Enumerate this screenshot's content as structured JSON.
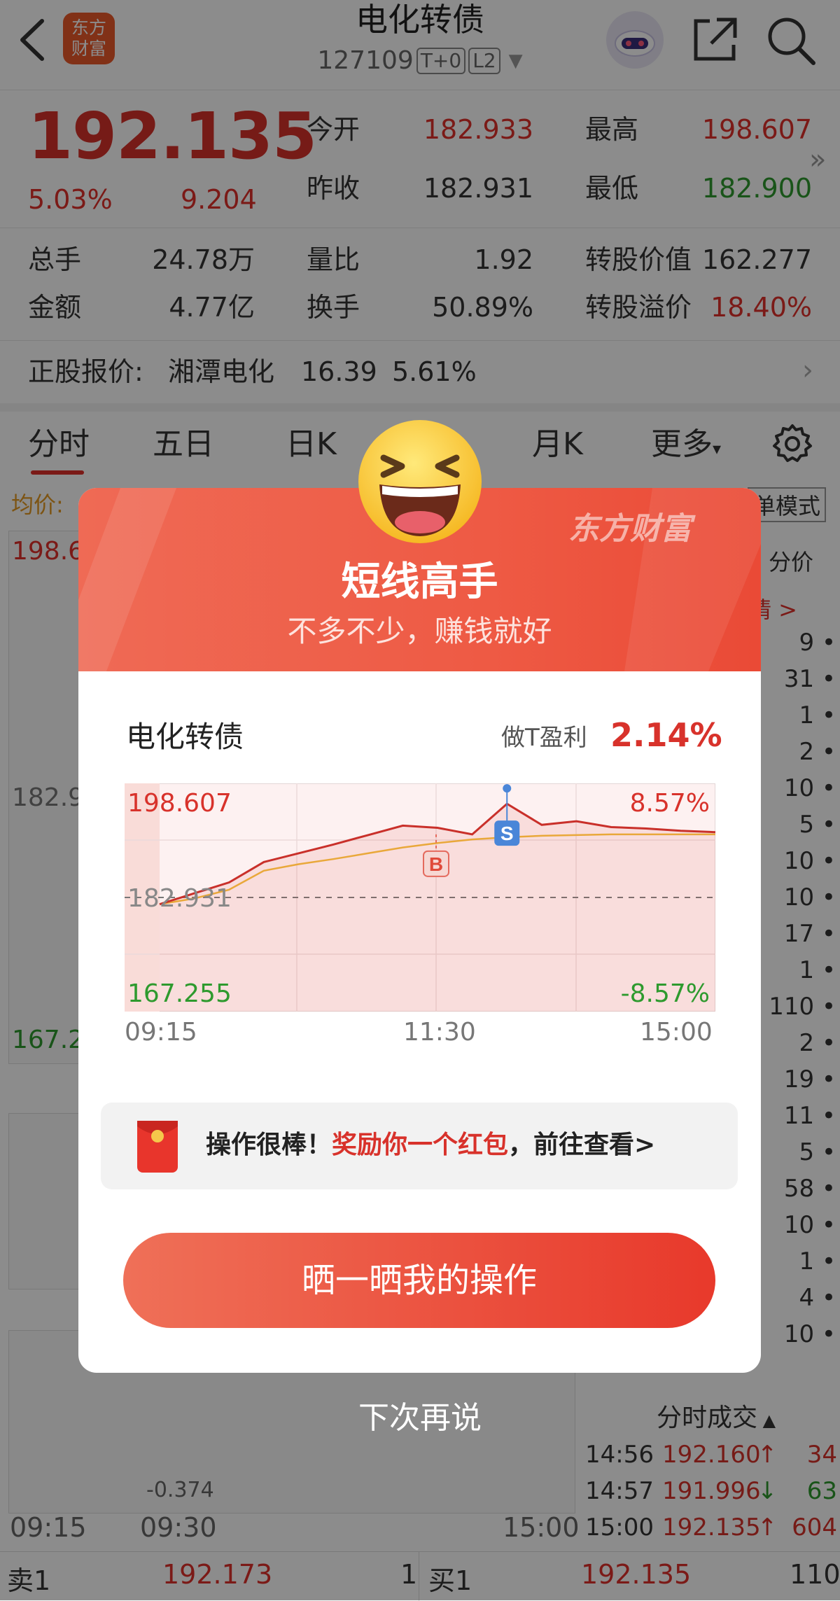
{
  "header": {
    "title": "电化转债",
    "code": "127109",
    "tag_t0": "T+0",
    "tag_l2": "L2",
    "logo_line1": "东方",
    "logo_line2": "财富"
  },
  "quote": {
    "price": "192.135",
    "change_pct": "5.03%",
    "change_amt": "9.204",
    "open_label": "今开",
    "open": "182.933",
    "high_label": "最高",
    "high": "198.607",
    "prev_close_label": "昨收",
    "prev_close": "182.931",
    "low_label": "最低",
    "low": "182.900",
    "volume_label": "总手",
    "volume": "24.78万",
    "vol_ratio_label": "量比",
    "vol_ratio": "1.92",
    "conv_value_label": "转股价值",
    "conv_value": "162.277",
    "amount_label": "金额",
    "amount": "4.77亿",
    "turnover_label": "换手",
    "turnover": "50.89%",
    "conv_premium_label": "转股溢价",
    "conv_premium": "18.40%"
  },
  "underlying": {
    "label": "正股报价:",
    "name": "湘潭电化",
    "price": "16.39",
    "change": "5.61%"
  },
  "tabs": [
    {
      "label": "分时"
    },
    {
      "label": "五日"
    },
    {
      "label": "日K"
    },
    {
      "label": "月K"
    },
    {
      "label": "更多"
    }
  ],
  "background": {
    "avg_label": "均价:",
    "mode_label": "单模式",
    "price_col_label": "分价",
    "detail_link": "情 >",
    "price_top": "198.6",
    "price_mid": "182.9",
    "price_bottom": "167.2",
    "vol_right": [
      "9",
      "31",
      "1",
      "2",
      "10",
      "5",
      "10",
      "10",
      "17",
      "1",
      "110",
      "2",
      "19",
      "11",
      "5",
      "58",
      "10",
      "1",
      "4",
      "10"
    ],
    "macd_value": "-0.374",
    "time_start": "09:15",
    "time_mid": "09:30",
    "time_end": "15:00",
    "ticks_title": "分时成交",
    "ticks": [
      {
        "time": "14:56",
        "price": "192.160",
        "arrow": "↑",
        "vol": "34"
      },
      {
        "time": "14:57",
        "price": "191.996",
        "arrow": "↓",
        "vol": "63"
      },
      {
        "time": "15:00",
        "price": "192.135",
        "arrow": "↑",
        "vol": "604"
      }
    ]
  },
  "order_bar": {
    "sell_label": "卖1",
    "sell_price": "192.173",
    "sell_vol": "1",
    "buy_label": "买1",
    "buy_price": "192.135",
    "buy_vol": "110"
  },
  "modal": {
    "brand": "东方财富",
    "title": "短线高手",
    "subtitle": "不多不少，赚钱就好",
    "stock_name": "电化转债",
    "profit_label": "做T盈利",
    "profit_value": "2.14%",
    "chart": {
      "y_top": "198.607",
      "y_mid": "182.931",
      "y_bottom": "167.255",
      "pct_top": "8.57%",
      "pct_bottom": "-8.57%",
      "buy_marker": "B",
      "sell_marker": "S",
      "time_start": "09:15",
      "time_mid": "11:30",
      "time_end": "15:00"
    },
    "reward_prefix": "操作很棒！",
    "reward_highlight": "奖励你一个红包",
    "reward_suffix": "，前往查看>",
    "share_button": "晒一晒我的操作",
    "later_link": "下次再说"
  },
  "chart_data": {
    "type": "line",
    "ylim": [
      167.255,
      198.607
    ],
    "reference": 182.931,
    "x_ticks": [
      "09:15",
      "11:30",
      "15:00"
    ],
    "series": [
      {
        "values": [
          182.0,
          183.5,
          185.0,
          187.8,
          189.0,
          190.2,
          191.5,
          192.8,
          192.5,
          191.6,
          195.8,
          192.9,
          193.4,
          192.6,
          192.4,
          192.1,
          191.9
        ]
      },
      {
        "values": [
          182.0,
          182.8,
          184.0,
          186.6,
          187.5,
          188.2,
          189.0,
          189.8,
          190.4,
          190.9,
          191.2,
          191.4,
          191.5,
          191.6,
          191.6,
          191.6,
          191.6
        ]
      }
    ],
    "markers": [
      {
        "label": "B",
        "x": "11:30",
        "price": 191.6
      },
      {
        "label": "S",
        "price": 195.8
      }
    ]
  }
}
